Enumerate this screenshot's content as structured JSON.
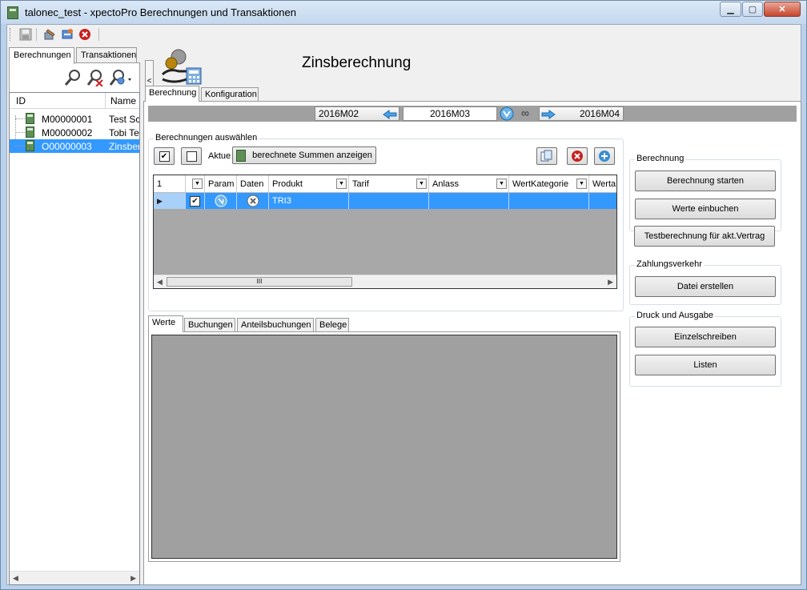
{
  "window": {
    "title": "talonec_test - xpectoPro Berechnungen und Transaktionen",
    "minimize": "▁",
    "maximize": "▢",
    "close": "✕"
  },
  "left_panel": {
    "tabs": [
      "Berechnungen",
      "Transaktionen"
    ],
    "columns": [
      "ID",
      "Name"
    ],
    "rows": [
      {
        "id": "M00000001",
        "name": "Test Scr"
      },
      {
        "id": "M00000002",
        "name": "Tobi Tes"
      },
      {
        "id": "O00000003",
        "name": "Zinsbere"
      }
    ],
    "collapse_label": "<"
  },
  "header": {
    "title": "Zinsberechnung"
  },
  "main_tabs": [
    "Berechnung",
    "Konfiguration"
  ],
  "period": {
    "prev": "2016M02",
    "current": "2016M03",
    "next": "2016M04",
    "link_symbol": "∞"
  },
  "selection_group": {
    "title": "Berechnungen auswählen",
    "aktuell_label": "Aktue",
    "show_sums_button": "berechnete Summen anzeigen"
  },
  "grid": {
    "columns": [
      "1",
      "",
      "Param",
      "Daten",
      "Produkt",
      "Tarif",
      "Anlass",
      "WertKategorie",
      "Werta"
    ],
    "rows": [
      {
        "produkt": "TRI3",
        "tarif": "",
        "anlass": "",
        "wertkategorie": "",
        "werta": ""
      }
    ],
    "scroll_thumb": "III"
  },
  "bottom_tabs": [
    "Werte",
    "Buchungen",
    "Anteilsbuchungen",
    "Belege"
  ],
  "right_groups": {
    "berechnung": {
      "title": "Berechnung",
      "buttons": [
        "Berechnung starten",
        "Werte einbuchen",
        "Testberechnung für akt.Vertrag"
      ]
    },
    "zahlungsverkehr": {
      "title": "Zahlungsverkehr",
      "buttons": [
        "Datei erstellen"
      ]
    },
    "druck": {
      "title": "Druck und Ausgabe",
      "buttons": [
        "Einzelschreiben",
        "Listen"
      ]
    }
  },
  "colors": {
    "selection": "#3399ff",
    "grid_bg": "#a8a8a8",
    "panel_bg": "#f0f0f0"
  }
}
